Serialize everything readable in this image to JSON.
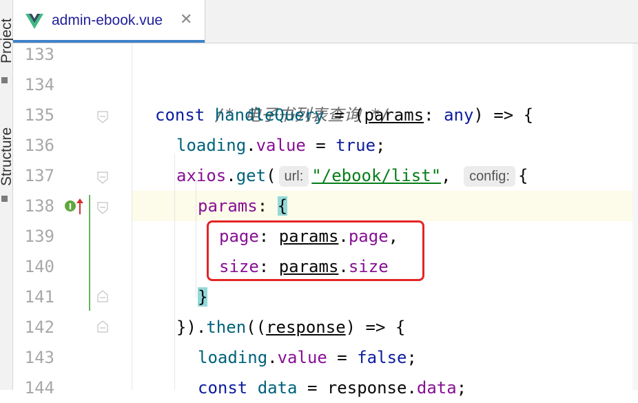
{
  "toolstrip": {
    "project_label": "Project",
    "structure_label": "Structure"
  },
  "tab": {
    "title": "admin-ebook.vue",
    "close_glyph": "✕",
    "icon": "vue-icon"
  },
  "colors": {
    "keyword": "#0d1d9c",
    "function": "#00627a",
    "property": "#871094",
    "string": "#067d17",
    "comment": "#6e6e6e",
    "callout": "#e32424",
    "current_line": "#fdfbe9",
    "vcs_added": "#62b35b"
  },
  "lines": [
    {
      "num": "133"
    },
    {
      "num": "134",
      "comment": "/* 电子书列表查询 */"
    },
    {
      "num": "135",
      "kw": "const",
      "fn": "handleQuery",
      "eq": " = (",
      "param": "params",
      "colon": ": ",
      "type": "any",
      "rest": ") => {"
    },
    {
      "num": "136",
      "prop": "loading",
      "dot": ".",
      "prop2": "value",
      "eq": " = ",
      "kw": "true",
      "end": ";"
    },
    {
      "num": "137",
      "fn": "axios",
      "dot": ".",
      "fn2": "get",
      "open": "(",
      "hint1": "url:",
      "str": "\"/ebook/list\"",
      "comma": ",",
      "hint2": "config:",
      "brace": "{"
    },
    {
      "num": "138",
      "prop": "params",
      "colon": ": ",
      "brace": "{"
    },
    {
      "num": "139",
      "prop": "page",
      "colon": ": ",
      "param": "params",
      "dot": ".",
      "prop2": "page",
      "end": ","
    },
    {
      "num": "140",
      "prop": "size",
      "colon": ": ",
      "param": "params",
      "dot": ".",
      "prop2": "size"
    },
    {
      "num": "141",
      "brace": "}"
    },
    {
      "num": "142",
      "pre": "}).",
      "fn": "then",
      "open": "((",
      "param": "response",
      "rest": ") => {"
    },
    {
      "num": "143",
      "prop": "loading",
      "dot": ".",
      "prop2": "value",
      "eq": " = ",
      "kw": "false",
      "end": ";"
    },
    {
      "num": "144",
      "kw": "const",
      "prop": "data",
      "eq": " = ",
      "param": "response",
      "dot": ".",
      "prop2": "data",
      "end": ";"
    }
  ]
}
